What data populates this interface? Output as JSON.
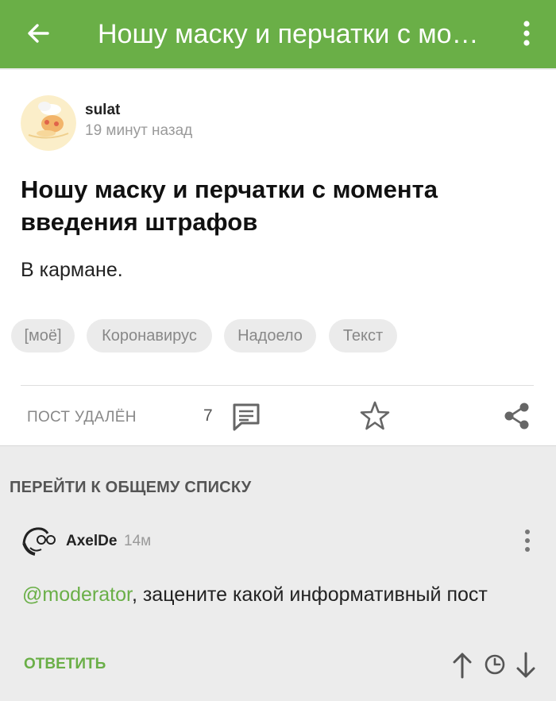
{
  "app_bar": {
    "title": "Ношу маску и перчатки с мо…",
    "color": "#6aaf47",
    "back_icon": "arrow-back-icon",
    "menu_icon": "more-vert-icon"
  },
  "post": {
    "author": "sulat",
    "time": "19 минут назад",
    "title": "Ношу маску и перчатки с момента введения штрафов",
    "body": "В кармане.",
    "tags": [
      "[моё]",
      "Коронавирус",
      "Надоело",
      "Текст"
    ],
    "status": "ПОСТ УДАЛЁН",
    "comment_count": "7",
    "comments_icon": "comments-icon",
    "favorite_icon": "star-icon",
    "share_icon": "share-icon"
  },
  "jump_link": "ПЕРЕЙТИ К ОБЩЕМУ СПИСКУ",
  "comment": {
    "author": "AxelDe",
    "time": "14м",
    "mention": "@moderator",
    "text": ", зацените какой информативный пост",
    "reply_label": "ОТВЕТИТЬ",
    "upvote_icon": "arrow-up-icon",
    "history_icon": "clock-icon",
    "downvote_icon": "arrow-down-icon",
    "accent_color": "#6aaf47"
  }
}
